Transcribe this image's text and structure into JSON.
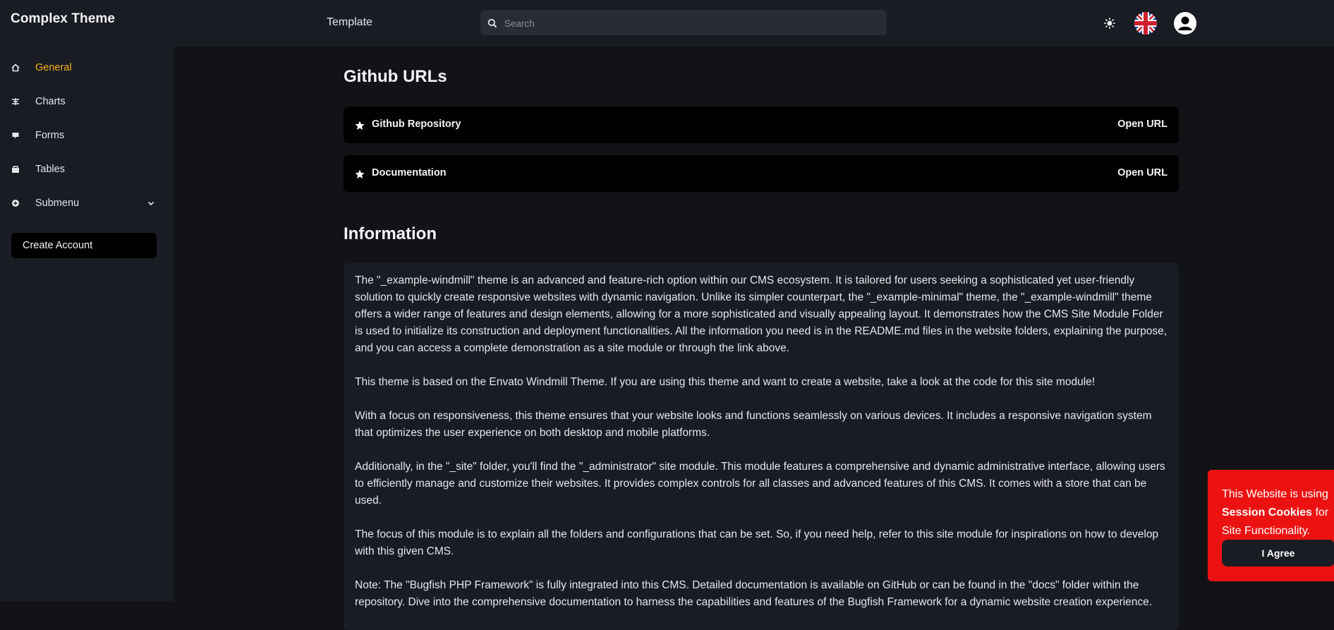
{
  "sidebar": {
    "brand": "Complex Theme",
    "items": [
      {
        "label": "General",
        "icon": "home-icon",
        "active": true
      },
      {
        "label": "Charts",
        "icon": "chart-icon"
      },
      {
        "label": "Forms",
        "icon": "forms-icon"
      },
      {
        "label": "Tables",
        "icon": "tables-icon"
      },
      {
        "label": "Submenu",
        "icon": "submenu-icon"
      }
    ],
    "create_account": "Create Account"
  },
  "header": {
    "title": "Template",
    "search_placeholder": "Search",
    "icons": [
      "theme-toggle-icon",
      "uk-flag-icon",
      "user-avatar-icon"
    ]
  },
  "main": {
    "github_title": "Github URLs",
    "urls": [
      {
        "name": "Github Repository",
        "action": "Open URL"
      },
      {
        "name": "Documentation",
        "action": "Open URL"
      }
    ],
    "info_title": "Information",
    "paragraphs": [
      "The \"_example-windmill\" theme is an advanced and feature-rich option within our CMS ecosystem. It is tailored for users seeking a sophisticated yet user-friendly solution to quickly create responsive websites with dynamic navigation. Unlike its simpler counterpart, the \"_example-minimal\" theme, the \"_example-windmill\" theme offers a wider range of features and design elements, allowing for a more sophisticated and visually appealing layout. It demonstrates how the CMS Site Module Folder is used to initialize its construction and deployment functionalities. All the information you need is in the README.md files in the website folders, explaining the purpose, and you can access a complete demonstration as a site module or through the link above.",
      "This theme is based on the Envato Windmill Theme. If you are using this theme and want to create a website, take a look at the code for this site module!",
      "With a focus on responsiveness, this theme ensures that your website looks and functions seamlessly on various devices. It includes a responsive navigation system that optimizes the user experience on both desktop and mobile platforms.",
      "Additionally, in the \"_site\" folder, you'll find the \"_administrator\" site module. This module features a comprehensive and dynamic administrative interface, allowing users to efficiently manage and customize their websites. It provides complex controls for all classes and advanced features of this CMS. It comes with a store that can be used.",
      "The focus of this module is to explain all the folders and configurations that can be set. So, if you need help, refer to this site module for inspirations on how to develop with this given CMS.",
      "Note: The \"Bugfish PHP Framework\" is fully integrated into this CMS. Detailed documentation is available on GitHub or can be found in the \"docs\" folder within the repository. Dive into the comprehensive documentation to harness the capabilities and features of the Bugfish Framework for a dynamic website creation experience."
    ]
  },
  "cookie": {
    "text_before": "This Website is using ",
    "text_bold": "Session Cookies",
    "text_after": " for Site Functionality.",
    "agree": "I Agree"
  },
  "colors": {
    "accent": "#f6ad1b",
    "sidebar_bg": "#1a1c23",
    "page_bg": "#121317",
    "card_bg": "#000000",
    "cookie_bg": "#ed1212"
  }
}
